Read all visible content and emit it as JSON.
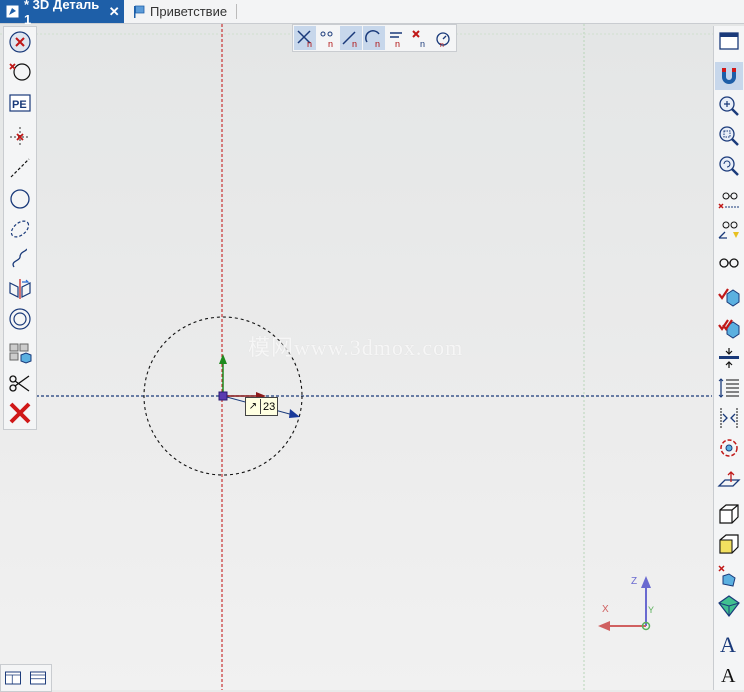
{
  "tabs": [
    {
      "label": "* 3D Деталь 1",
      "icon": "part-document-icon",
      "close": "✕",
      "active": true
    },
    {
      "label": "Приветствие",
      "icon": "flag-icon",
      "active": false
    }
  ],
  "sketch": {
    "dimension_value": "23"
  },
  "axes": {
    "x_label": "X",
    "y_label": "Y",
    "z_label": "Z"
  },
  "watermark": "模网www.3dmox.com",
  "colors": {
    "tab_active": "#1e5fa8",
    "axis_vertical": "#c83232",
    "axis_horizontal": "#1a3a7a",
    "origin_arrow_y": "#1e8a1e",
    "origin_arrow_x": "#8b1a1a",
    "triad_z": "#6a6ad0",
    "triad_x": "#d06060",
    "triad_y": "#5ab05a"
  },
  "left_toolbar": [
    "cancel-icon",
    "delete-point-icon",
    "parametric-mode-icon",
    "point-icon",
    "line-icon",
    "circle-icon",
    "ellipse-icon",
    "spline-icon",
    "mirror-icon",
    "concentric-circles-icon",
    "library-icon",
    "scissors-icon",
    "close-sketch-icon"
  ],
  "top_toolbar": [
    "snap-intersection-icon",
    "snap-points-icon",
    "snap-tangent-icon",
    "snap-arc-icon",
    "snap-align-icon",
    "snap-off-icon",
    "snap-settings-icon"
  ],
  "right_toolbar": [
    "window-icon",
    "magnet-icon",
    "zoom-icon",
    "zoom-window-icon",
    "zoom-previous-icon",
    "hide-constraints-icon",
    "show-dimensions-icon",
    "view-glasses-icon",
    "check-solid-icon",
    "check-solid-multi-icon",
    "align-icon",
    "vertical-spacing-icon",
    "distribute-icon",
    "rotate-icon",
    "plane-icon",
    "wireframe-cube-icon",
    "shaded-face-icon",
    "cut-shape-icon",
    "shaded-solid-icon",
    "text-style-icon",
    "text-icon"
  ],
  "bottom_toolbar": [
    "view-split-icon",
    "view-grid-icon"
  ]
}
